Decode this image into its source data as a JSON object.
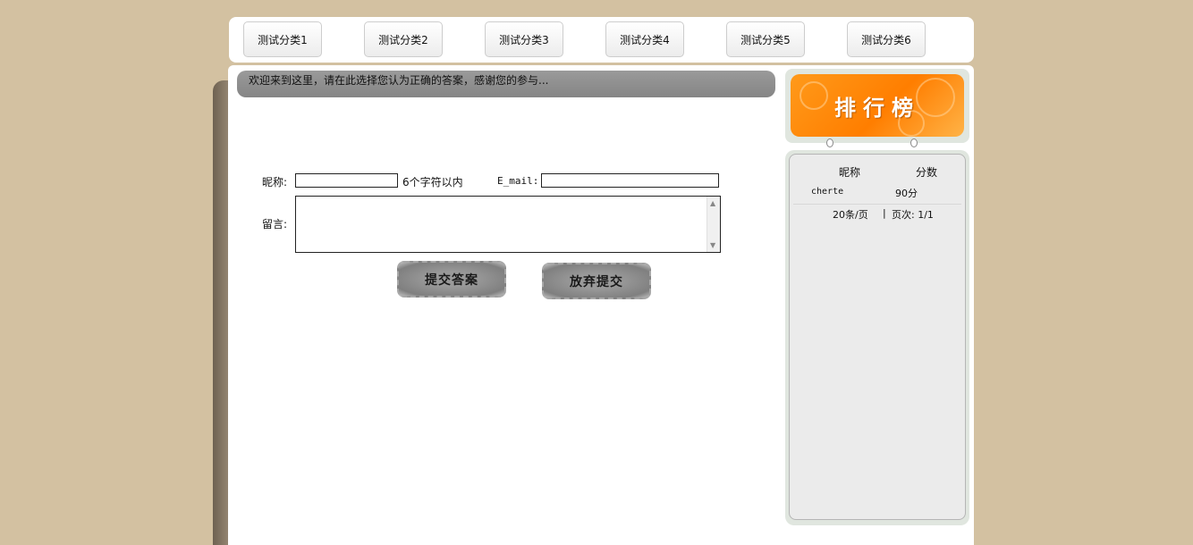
{
  "nav": {
    "tabs": [
      {
        "label": "测试分类1"
      },
      {
        "label": "测试分类2"
      },
      {
        "label": "测试分类3"
      },
      {
        "label": "测试分类4"
      },
      {
        "label": "测试分类5"
      },
      {
        "label": "测试分类6"
      }
    ]
  },
  "welcome": {
    "text": "欢迎来到这里，请在此选择您认为正确的答案，感谢您的参与..."
  },
  "form": {
    "nickname_label": "昵称:",
    "nickname_value": "",
    "nickname_hint": "6个字符以内",
    "email_label": "E_mail:",
    "email_value": "",
    "message_label": "留言:",
    "message_value": "",
    "submit_label": "提交答案",
    "cancel_label": "放弃提交"
  },
  "ranking": {
    "title": "排行榜",
    "columns": [
      "昵称",
      "分数"
    ],
    "rows": [
      {
        "name": "cherte",
        "score": "90分"
      }
    ],
    "per_page": "20条/页",
    "separator": "|",
    "page_info": "页次: 1/1"
  },
  "colors": {
    "page_bg": "#d3c1a1",
    "banner_orange": "#ff7e00",
    "welcome_bar": "#8c8c8c"
  }
}
